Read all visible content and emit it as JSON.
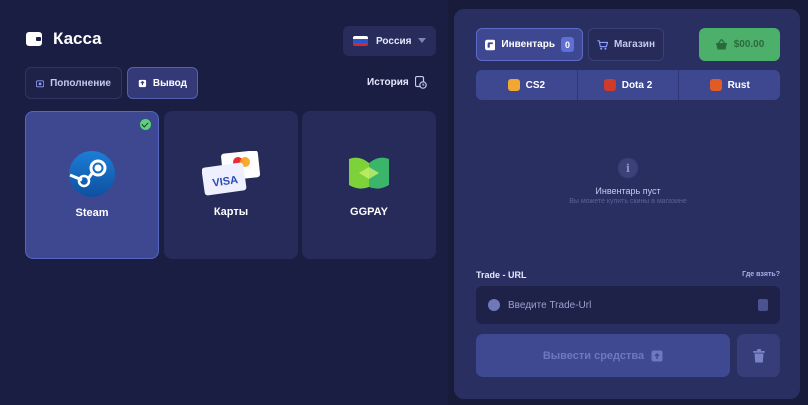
{
  "header": {
    "title": "Касса"
  },
  "region": {
    "selected": "Россия"
  },
  "tabs": {
    "deposit": "Пополнение",
    "withdraw": "Вывод"
  },
  "history": {
    "label": "История"
  },
  "methods": [
    {
      "label": "Steam",
      "selected": true
    },
    {
      "label": "Карты",
      "selected": false,
      "badge": "VISA"
    },
    {
      "label": "GGPAY",
      "selected": false
    }
  ],
  "right": {
    "inventory_tab": "Инвентарь",
    "inventory_count": "0",
    "shop_tab": "Магазин",
    "balance": "$00.00",
    "games": [
      {
        "label": "CS2",
        "color": "#f0a832"
      },
      {
        "label": "Dota 2",
        "color": "#d03a2b"
      },
      {
        "label": "Rust",
        "color": "#e25a25"
      }
    ],
    "inventory": {
      "info_glyph": "i",
      "empty_title": "Инвентарь пуст",
      "empty_sub": "Вы можете купить скины в магазине"
    },
    "trade": {
      "label": "Trade - URL",
      "help": "Где взять?",
      "placeholder": "Введите Trade-Url"
    },
    "withdraw_button": "Вывести средства"
  },
  "colors": {
    "accent": "#3d4890",
    "balance_green": "#4caf6a",
    "check_green": "#5cd07a"
  }
}
